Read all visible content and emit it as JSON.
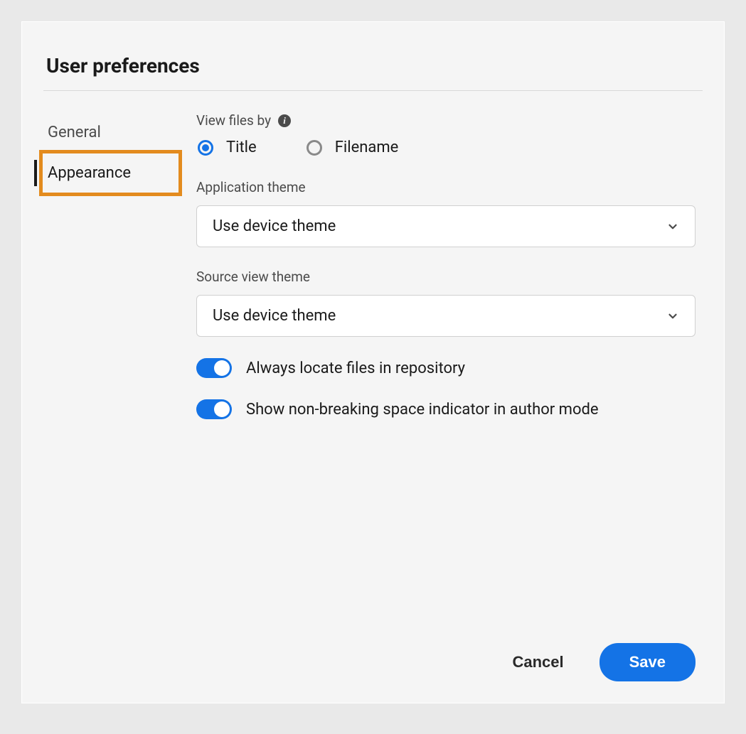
{
  "title": "User preferences",
  "sidebar": {
    "items": [
      {
        "label": "General"
      },
      {
        "label": "Appearance"
      }
    ]
  },
  "content": {
    "view_files_by": {
      "label": "View files by",
      "options": [
        {
          "label": "Title",
          "selected": true
        },
        {
          "label": "Filename",
          "selected": false
        }
      ]
    },
    "application_theme": {
      "label": "Application theme",
      "value": "Use device theme"
    },
    "source_view_theme": {
      "label": "Source view theme",
      "value": "Use device theme"
    },
    "toggle_locate": {
      "label": "Always locate files in repository",
      "on": true
    },
    "toggle_nbsp": {
      "label": "Show non-breaking space indicator in author mode",
      "on": true
    }
  },
  "footer": {
    "cancel": "Cancel",
    "save": "Save"
  }
}
